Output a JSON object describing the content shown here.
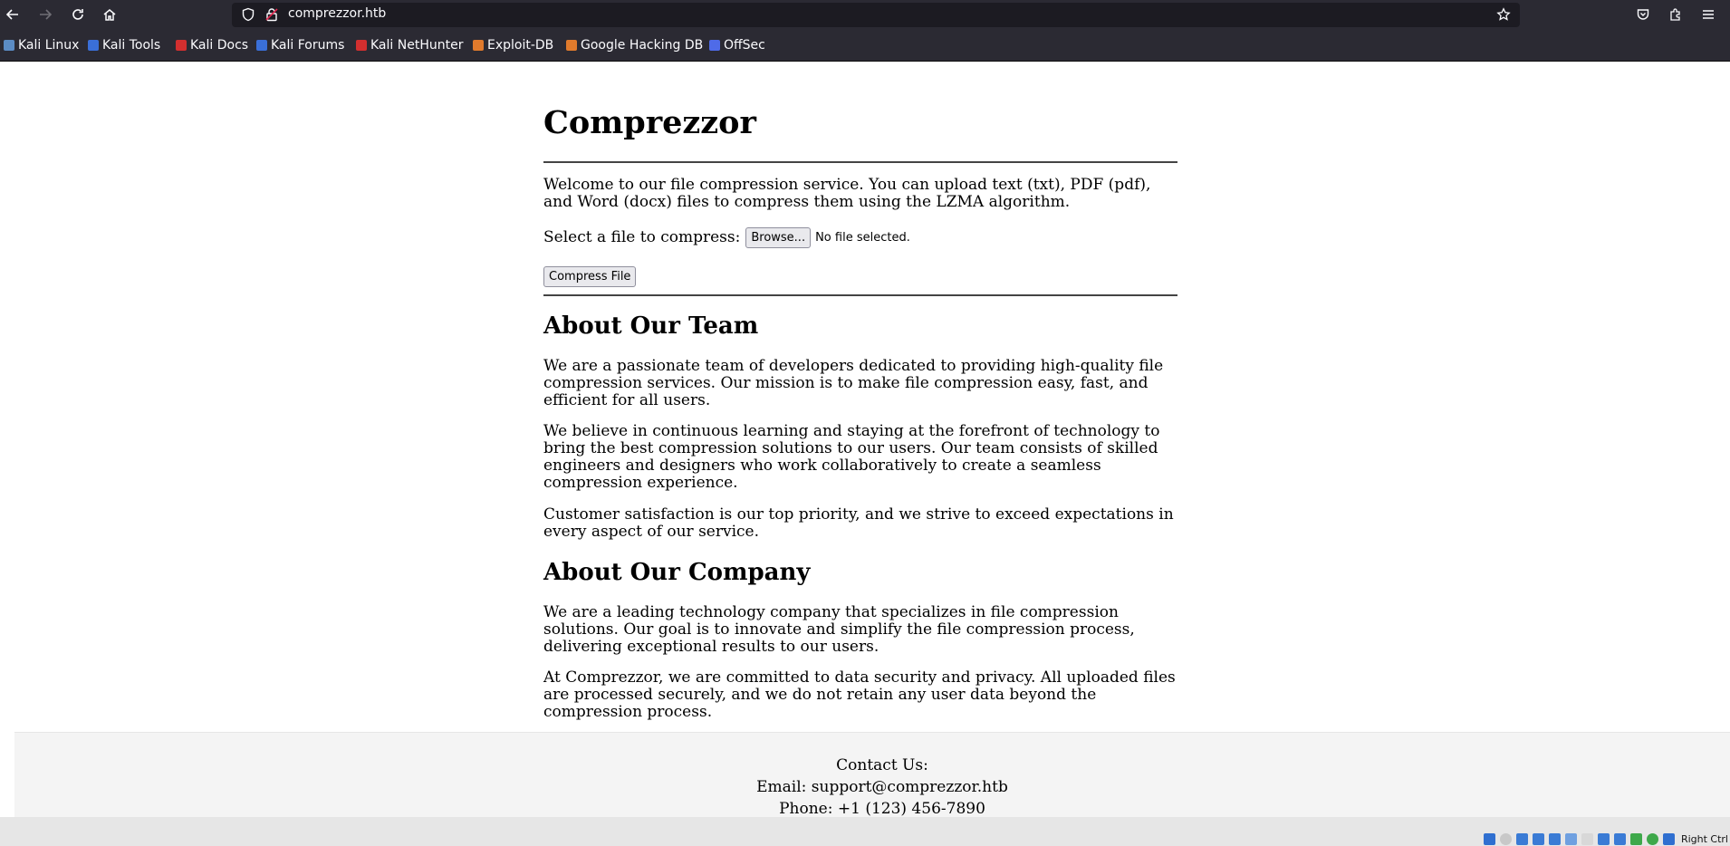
{
  "browser": {
    "url": "comprezzor.htb",
    "bookmarks": [
      {
        "label": "Kali Linux",
        "icon_color": "#5b8cc4"
      },
      {
        "label": "Kali Tools",
        "icon_color": "#3a6fd8"
      },
      {
        "label": "Kali Docs",
        "icon_color": "#d32f2f"
      },
      {
        "label": "Kali Forums",
        "icon_color": "#3a6fd8"
      },
      {
        "label": "Kali NetHunter",
        "icon_color": "#d32f2f"
      },
      {
        "label": "Exploit-DB",
        "icon_color": "#e07a2c"
      },
      {
        "label": "Google Hacking DB",
        "icon_color": "#e07a2c"
      },
      {
        "label": "OffSec",
        "icon_color": "#4f6be8"
      }
    ]
  },
  "page": {
    "title": "Comprezzor",
    "intro": "Welcome to our file compression service. You can upload text (txt), PDF (pdf), and Word (docx) files to compress them using the LZMA algorithm.",
    "file_label": "Select a file to compress:",
    "browse_label": "Browse...",
    "file_status": "No file selected.",
    "compress_label": "Compress File",
    "team_heading": "About Our Team",
    "team_paragraphs": [
      "We are a passionate team of developers dedicated to providing high-quality file compression services. Our mission is to make file compression easy, fast, and efficient for all users.",
      "We believe in continuous learning and staying at the forefront of technology to bring the best compression solutions to our users. Our team consists of skilled engineers and designers who work collaboratively to create a seamless compression experience.",
      "Customer satisfaction is our top priority, and we strive to exceed expectations in every aspect of our service."
    ],
    "company_heading": "About Our Company",
    "company_paragraphs": [
      "We are a leading technology company that specializes in file compression solutions. Our goal is to innovate and simplify the file compression process, delivering exceptional results to our users.",
      "At Comprezzor, we are committed to data security and privacy. All uploaded files are processed securely, and we do not retain any user data beyond the compression process."
    ]
  },
  "footer": {
    "contact_heading": "Contact Us:",
    "email": "Email: support@comprezzor.htb",
    "phone": "Phone: +1 (123) 456-7890"
  },
  "vm_statusbar": {
    "host_key": "Right Ctrl"
  }
}
